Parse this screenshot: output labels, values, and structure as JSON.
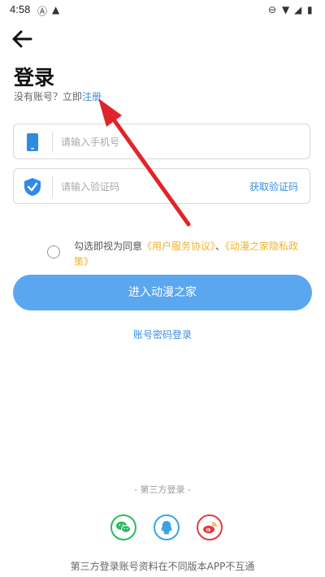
{
  "status_bar": {
    "time": "4:58"
  },
  "header": {
    "title": "登录"
  },
  "subtitle": {
    "prefix": "没有账号？立即",
    "register_link": "注册"
  },
  "phone_field": {
    "placeholder": "请输入手机号"
  },
  "code_field": {
    "placeholder": "请输入验证码",
    "get_code_label": "获取验证码"
  },
  "agreement": {
    "prefix": "勾选即视为同意",
    "user_agreement": "《用户服务协议》",
    "separator": "、",
    "privacy_policy": "《动漫之家隐私政策》"
  },
  "enter_button": {
    "label": "进入动漫之家"
  },
  "password_login": {
    "label": "账号密码登录"
  },
  "third_party": {
    "title": "-   第三方登录   -",
    "icons": [
      "wechat-icon",
      "qq-icon",
      "weibo-icon"
    ],
    "notice": "第三方登录账号资料在不同版本APP不互通"
  },
  "colors": {
    "accent": "#3b8fe0",
    "button": "#5aa7f0",
    "highlight": "#f0b429",
    "annotation_arrow": "#e0242b"
  }
}
